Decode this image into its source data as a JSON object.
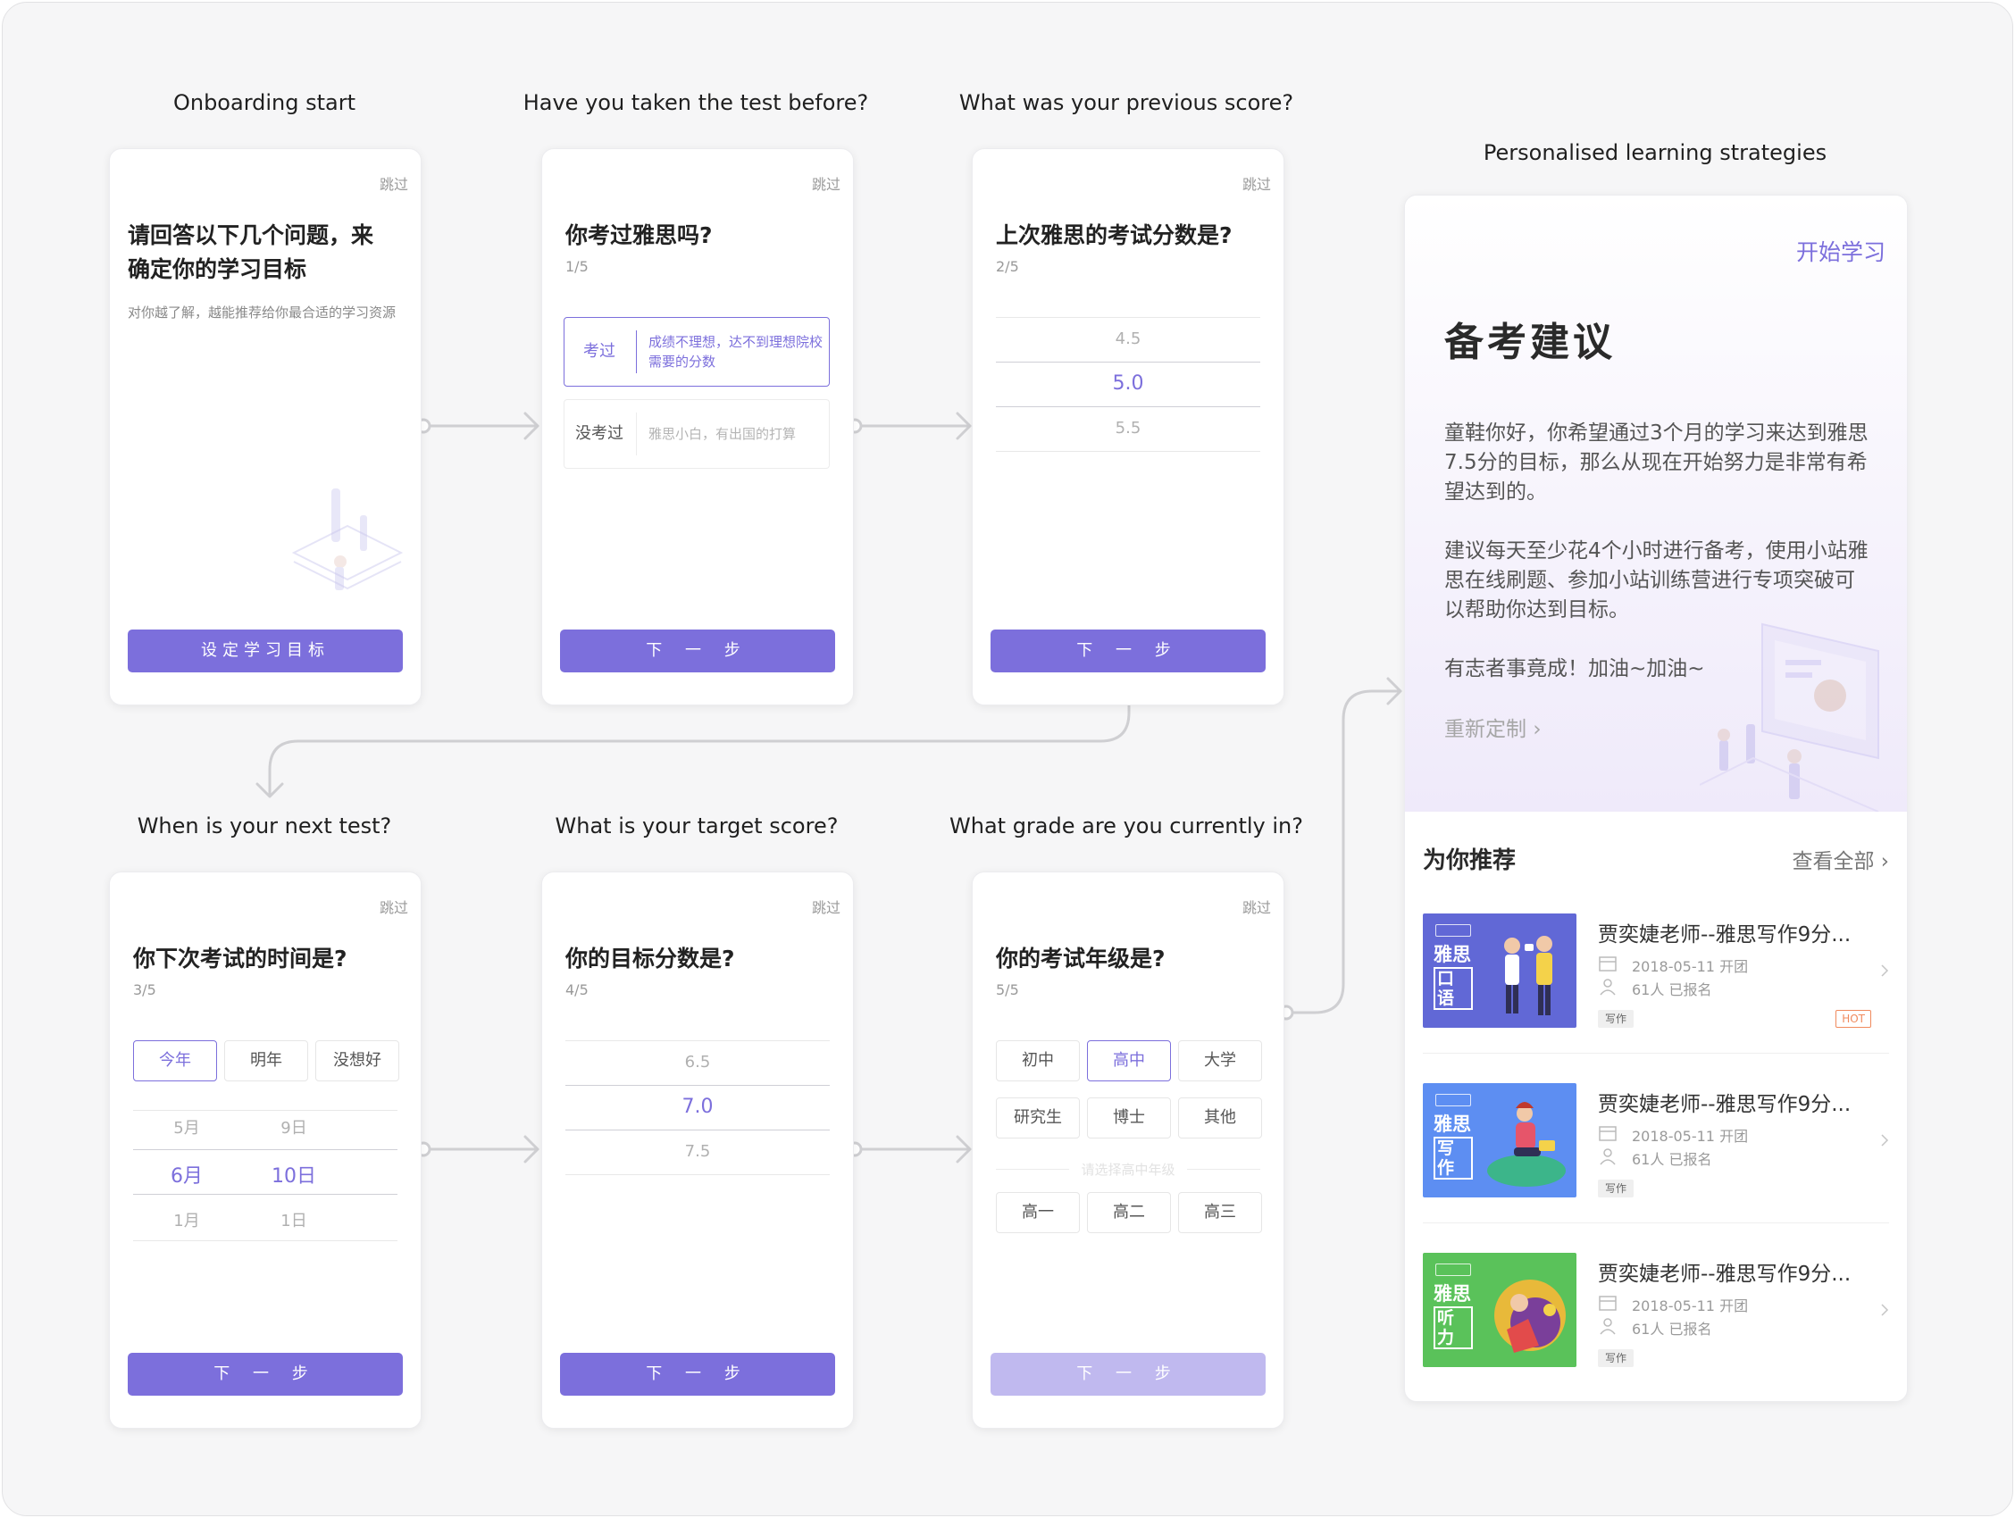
{
  "captions": {
    "c1": "Onboarding start",
    "c2": "Have you taken the test before?",
    "c3": "What was your previous score?",
    "c4": "When is your next test?",
    "c5": "What is your target score?",
    "c6": "What grade are you currently in?",
    "c7": "Personalised learning strategies"
  },
  "skip": "跳过",
  "screen1": {
    "title_line1": "请回答以下几个问题，来",
    "title_line2": "确定你的学习目标",
    "subtext": "对你越了解，越能推荐给你最合适的学习资源",
    "button": "设定学习目标"
  },
  "screen2": {
    "title": "你考过雅思吗?",
    "step": "1/5",
    "option1_label": "考过",
    "option1_desc": "成绩不理想，达不到理想院校需要的分数",
    "option2_label": "没考过",
    "option2_desc": "雅思小白，有出国的打算",
    "button": "下 一 步"
  },
  "screen3": {
    "title": "上次雅思的考试分数是?",
    "step": "2/5",
    "picker": [
      "4.5",
      "5.0",
      "5.5"
    ],
    "button": "下 一 步"
  },
  "screen4": {
    "title": "你下次考试的时间是?",
    "step": "3/5",
    "chips": [
      "今年",
      "明年",
      "没想好"
    ],
    "months": [
      "5月",
      "6月",
      "1月"
    ],
    "days": [
      "9日",
      "10日",
      "1日"
    ],
    "button": "下 一 步"
  },
  "screen5": {
    "title": "你的目标分数是?",
    "step": "4/5",
    "picker": [
      "6.5",
      "7.0",
      "7.5"
    ],
    "button": "下 一 步"
  },
  "screen6": {
    "title": "你的考试年级是?",
    "step": "5/5",
    "levels": [
      "初中",
      "高中",
      "大学",
      "研究生",
      "博士",
      "其他"
    ],
    "hint": "请选择高中年级",
    "grades": [
      "高一",
      "高二",
      "高三"
    ],
    "button": "下 一 步"
  },
  "strategy": {
    "start_link": "开始学习",
    "title": "备考建议",
    "para1": "童鞋你好，你希望通过3个月的学习来达到雅思7.5分的目标，那么从现在开始努力是非常有希望达到的。",
    "para2": "建议每天至少花4个小时进行备考，使用小站雅思在线刷题、参加小站训练营进行专项突破可以帮助你达到目标。",
    "para3": "有志者事竟成！加油~加油~",
    "recustom": "重新定制",
    "rec_title": "为你推荐",
    "view_all": "查看全部",
    "courses": [
      {
        "title": "贾奕婕老师--雅思写作9分...",
        "date": "2018-05-11 开团",
        "enrolled": "61人 已报名",
        "tag": "写作",
        "thumb_l1": "雅思",
        "thumb_l2": "口语",
        "hot": "HOT",
        "color": "#6168d6"
      },
      {
        "title": "贾奕婕老师--雅思写作9分...",
        "date": "2018-05-11 开团",
        "enrolled": "61人 已报名",
        "tag": "写作",
        "thumb_l1": "雅思",
        "thumb_l2": "写作",
        "color": "#5d8ef2"
      },
      {
        "title": "贾奕婕老师--雅思写作9分...",
        "date": "2018-05-11 开团",
        "enrolled": "61人 已报名",
        "tag": "写作",
        "thumb_l1": "雅思",
        "thumb_l2": "听力",
        "color": "#5ac25a"
      }
    ]
  },
  "colors": {
    "accent": "#7c6fdc",
    "accent_disabled": "#c0b9ef",
    "hot": "#f08a5d"
  }
}
